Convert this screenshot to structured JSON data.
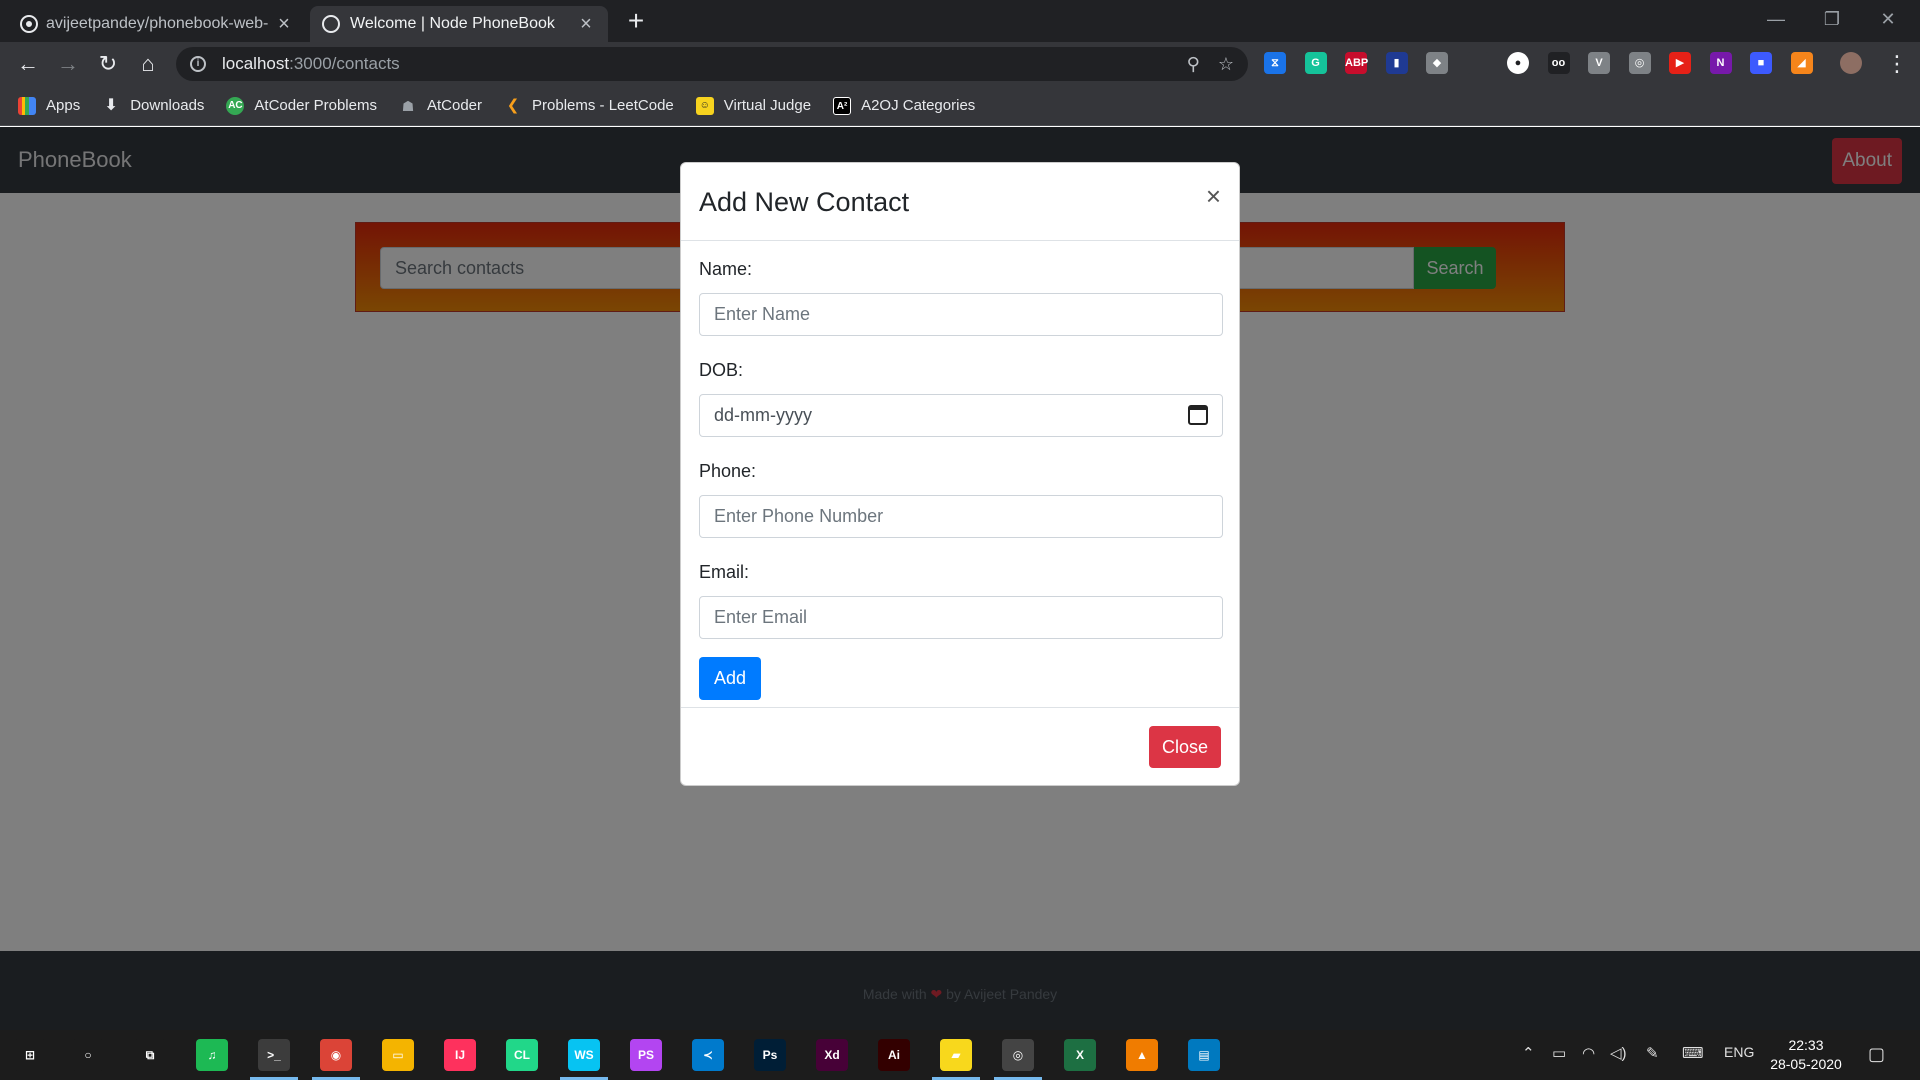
{
  "browser": {
    "tabs": [
      {
        "title": "avijeetpandey/phonebook-web-",
        "icon": "github-icon"
      },
      {
        "title": "Welcome | Node PhoneBook",
        "icon": "globe-icon"
      }
    ],
    "new_tab": "+",
    "url_host": "localhost",
    "url_path": ":3000/contacts",
    "bookmarks": [
      {
        "label": "Apps",
        "icon": "apps-grid-icon"
      },
      {
        "label": "Downloads",
        "icon": "download-icon"
      },
      {
        "label": "AtCoder Problems",
        "icon": "atcoder-problems-icon"
      },
      {
        "label": "AtCoder",
        "icon": "atcoder-icon"
      },
      {
        "label": "Problems - LeetCode",
        "icon": "leetcode-icon"
      },
      {
        "label": "Virtual Judge",
        "icon": "vjudge-icon"
      },
      {
        "label": "A2OJ Categories",
        "icon": "a2oj-icon"
      }
    ],
    "extensions": [
      {
        "glyph": "⧖",
        "color": "#1a73e8"
      },
      {
        "glyph": "G",
        "color": "#15c39a"
      },
      {
        "glyph": "ABP",
        "color": "#c70d2c"
      },
      {
        "glyph": "▮",
        "color": "#1f3a93"
      },
      {
        "glyph": "◆",
        "color": "#7e8286"
      },
      {
        "glyph": "",
        "color": "#35363a"
      },
      {
        "glyph": "●",
        "color": "#ffffff"
      },
      {
        "glyph": "oo",
        "color": "#202124"
      },
      {
        "glyph": "V",
        "color": "#7e8286"
      },
      {
        "glyph": "◎",
        "color": "#7e8286"
      },
      {
        "glyph": "▶",
        "color": "#e62117"
      },
      {
        "glyph": "N",
        "color": "#7719aa"
      },
      {
        "glyph": "■",
        "color": "#3d5afe"
      },
      {
        "glyph": "◢",
        "color": "#f6851b"
      }
    ]
  },
  "site": {
    "brand": "PhoneBook",
    "about": "About",
    "search_placeholder": "Search contacts",
    "search_button": "Search",
    "footer_prefix": "Made with",
    "footer_heart": "❤",
    "footer_suffix": "by Avijeet Pandey"
  },
  "modal": {
    "title": "Add New Contact",
    "close_x": "×",
    "fields": {
      "name_label": "Name:",
      "name_placeholder": "Enter Name",
      "dob_label": "DOB:",
      "dob_value": "dd-mm-yyyy",
      "phone_label": "Phone:",
      "phone_placeholder": "Enter Phone Number",
      "email_label": "Email:",
      "email_placeholder": "Enter Email"
    },
    "add_button": "Add",
    "close_button": "Close"
  },
  "taskbar": {
    "apps": [
      {
        "name": "windows-start-icon",
        "glyph": "⊞",
        "color": "#1c1c1c"
      },
      {
        "name": "cortana-search-icon",
        "glyph": "○",
        "color": "#1c1c1c"
      },
      {
        "name": "task-view-icon",
        "glyph": "⧉",
        "color": "#1c1c1c"
      },
      {
        "name": "spotify-icon",
        "glyph": "♫",
        "color": "#1db954"
      },
      {
        "name": "terminal-icon",
        "glyph": ">_",
        "color": "#3c3c3c"
      },
      {
        "name": "chrome-icon",
        "glyph": "◉",
        "color": "#db4437"
      },
      {
        "name": "file-explorer-icon",
        "glyph": "▭",
        "color": "#f4b400"
      },
      {
        "name": "intellij-icon",
        "glyph": "IJ",
        "color": "#fe315d"
      },
      {
        "name": "clion-icon",
        "glyph": "CL",
        "color": "#21d789"
      },
      {
        "name": "webstorm-icon",
        "glyph": "WS",
        "color": "#07c3f2"
      },
      {
        "name": "phpstorm-icon",
        "glyph": "PS",
        "color": "#b345f1"
      },
      {
        "name": "vscode-icon",
        "glyph": "≺",
        "color": "#007acc"
      },
      {
        "name": "photoshop-icon",
        "glyph": "Ps",
        "color": "#001e36"
      },
      {
        "name": "adobe-xd-icon",
        "glyph": "Xd",
        "color": "#470137"
      },
      {
        "name": "illustrator-icon",
        "glyph": "Ai",
        "color": "#330000"
      },
      {
        "name": "sticky-notes-icon",
        "glyph": "▰",
        "color": "#f8d81c"
      },
      {
        "name": "media-icon",
        "glyph": "◎",
        "color": "#444444"
      },
      {
        "name": "excel-icon",
        "glyph": "X",
        "color": "#1d6f42"
      },
      {
        "name": "vlc-icon",
        "glyph": "▲",
        "color": "#f07c00"
      },
      {
        "name": "trello-icon",
        "glyph": "▤",
        "color": "#0079bf"
      }
    ],
    "language": "ENG",
    "time": "22:33",
    "date": "28-05-2020"
  }
}
